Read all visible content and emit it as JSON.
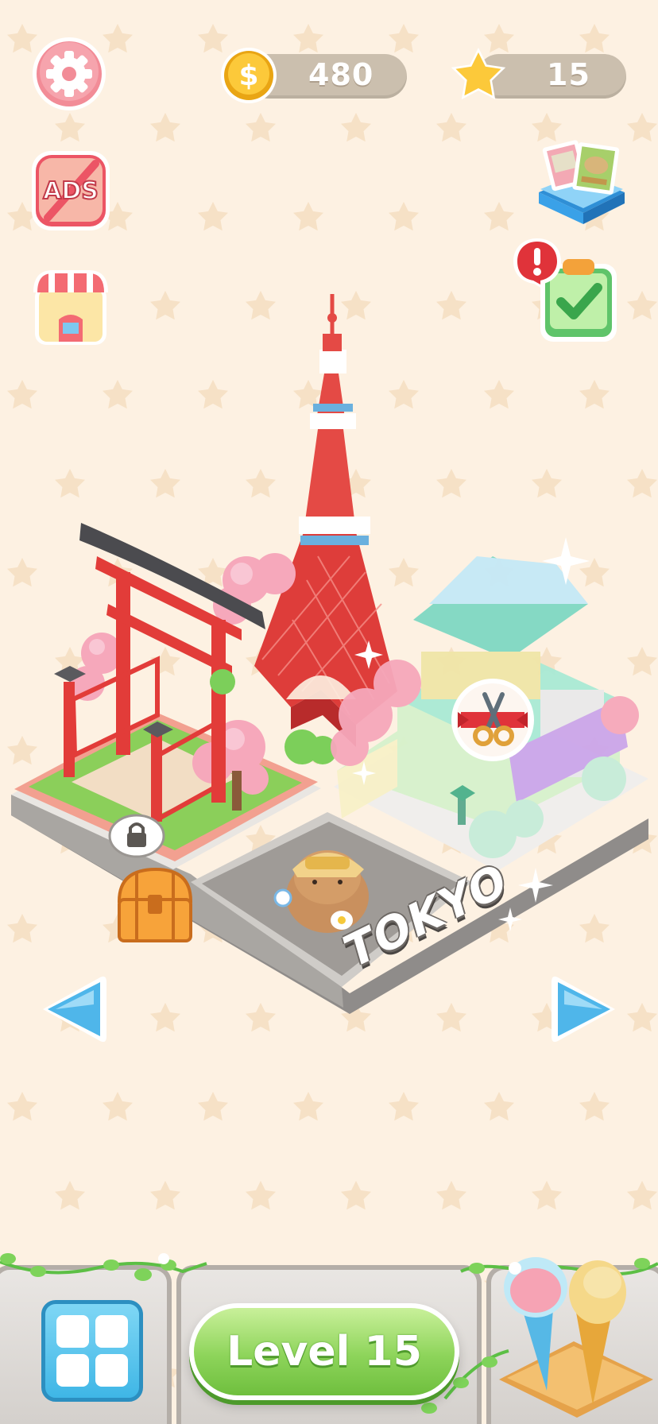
{
  "hud": {
    "coins": "480",
    "stars": "15"
  },
  "map": {
    "city_name": "TOKYO"
  },
  "bottom": {
    "level_label": "Level 15"
  },
  "icons": {
    "settings": "gear-icon",
    "ads": "no-ads-icon",
    "shop": "shop-icon",
    "stamps": "stamp-album-icon",
    "tasks": "task-checklist-icon",
    "alert": "alert-icon",
    "lock": "lock-icon",
    "chest": "treasure-chest-icon",
    "scissors": "ribbon-scissors-icon",
    "prev": "arrow-left-icon",
    "next": "arrow-right-icon",
    "grid": "grid-menu-icon",
    "icecream": "ice-cream-icon"
  },
  "ads_badge_text": "ADS",
  "colors": {
    "background": "#fdf1e2",
    "accent_green": "#8dd45a",
    "accent_red": "#e44a4a",
    "arrow_blue": "#4fb6ea",
    "pill_gray": "#cbbfae"
  }
}
